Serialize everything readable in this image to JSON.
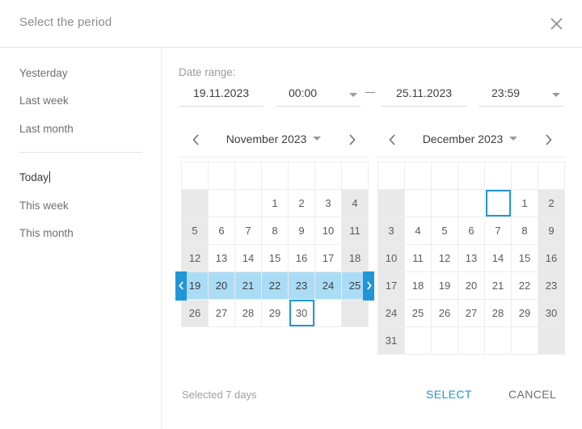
{
  "dialog": {
    "title": "Select the period",
    "close_icon": "close-icon"
  },
  "presets": {
    "items": [
      {
        "label": "Yesterday",
        "active": false
      },
      {
        "label": "Last week",
        "active": false
      },
      {
        "label": "Last month",
        "active": false
      },
      {
        "label": "Today",
        "active": true
      },
      {
        "label": "This week",
        "active": false
      },
      {
        "label": "This month",
        "active": false
      }
    ]
  },
  "date_range": {
    "label": "Date range:",
    "separator": "—",
    "start_date": "19.11.2023",
    "start_time": "00:00",
    "end_date": "25.11.2023",
    "end_time": "23:59"
  },
  "calendars": [
    {
      "title": "November 2023",
      "prev_icon": "chevron-left-icon",
      "next_icon": "chevron-right-icon",
      "caret_icon": "chevron-down-icon",
      "weeks": [
        [
          "",
          "",
          "",
          "",
          "",
          "",
          ""
        ],
        [
          "",
          "",
          "",
          "1",
          "2",
          "3",
          "4"
        ],
        [
          "5",
          "6",
          "7",
          "8",
          "9",
          "10",
          "11"
        ],
        [
          "12",
          "13",
          "14",
          "15",
          "16",
          "17",
          "18"
        ],
        [
          "19",
          "20",
          "21",
          "22",
          "23",
          "24",
          "25"
        ],
        [
          "26",
          "27",
          "28",
          "29",
          "30",
          "",
          ""
        ]
      ],
      "in_range": [
        "19",
        "20",
        "21",
        "22",
        "23",
        "24",
        "25"
      ],
      "today": "30",
      "empty_outline": null,
      "header_row": true,
      "handle_start_icon": "chevron-left-icon",
      "handle_end_icon": "chevron-right-icon"
    },
    {
      "title": "December 2023",
      "prev_icon": "chevron-left-icon",
      "next_icon": "chevron-right-icon",
      "caret_icon": "chevron-down-icon",
      "weeks": [
        [
          "",
          "",
          "",
          "",
          "",
          "",
          ""
        ],
        [
          "",
          "",
          "",
          "",
          "",
          "1",
          "2"
        ],
        [
          "3",
          "4",
          "5",
          "6",
          "7",
          "8",
          "9"
        ],
        [
          "10",
          "11",
          "12",
          "13",
          "14",
          "15",
          "16"
        ],
        [
          "17",
          "18",
          "19",
          "20",
          "21",
          "22",
          "23"
        ],
        [
          "24",
          "25",
          "26",
          "27",
          "28",
          "29",
          "30"
        ],
        [
          "31",
          "",
          "",
          "",
          "",
          "",
          ""
        ]
      ],
      "in_range": [],
      "today": null,
      "empty_outline": {
        "row": 1,
        "col": 4
      },
      "header_row": true,
      "handle_start_icon": null,
      "handle_end_icon": null
    }
  ],
  "footer": {
    "selected_info": "Selected 7 days",
    "select_label": "SELECT",
    "cancel_label": "CANCEL"
  },
  "colors": {
    "accent": "#2196d6",
    "range_fill": "#aadcf5",
    "weekend_bg": "#e9e9e9",
    "grid_line": "#ededed",
    "muted_text": "#9b9b9b"
  }
}
